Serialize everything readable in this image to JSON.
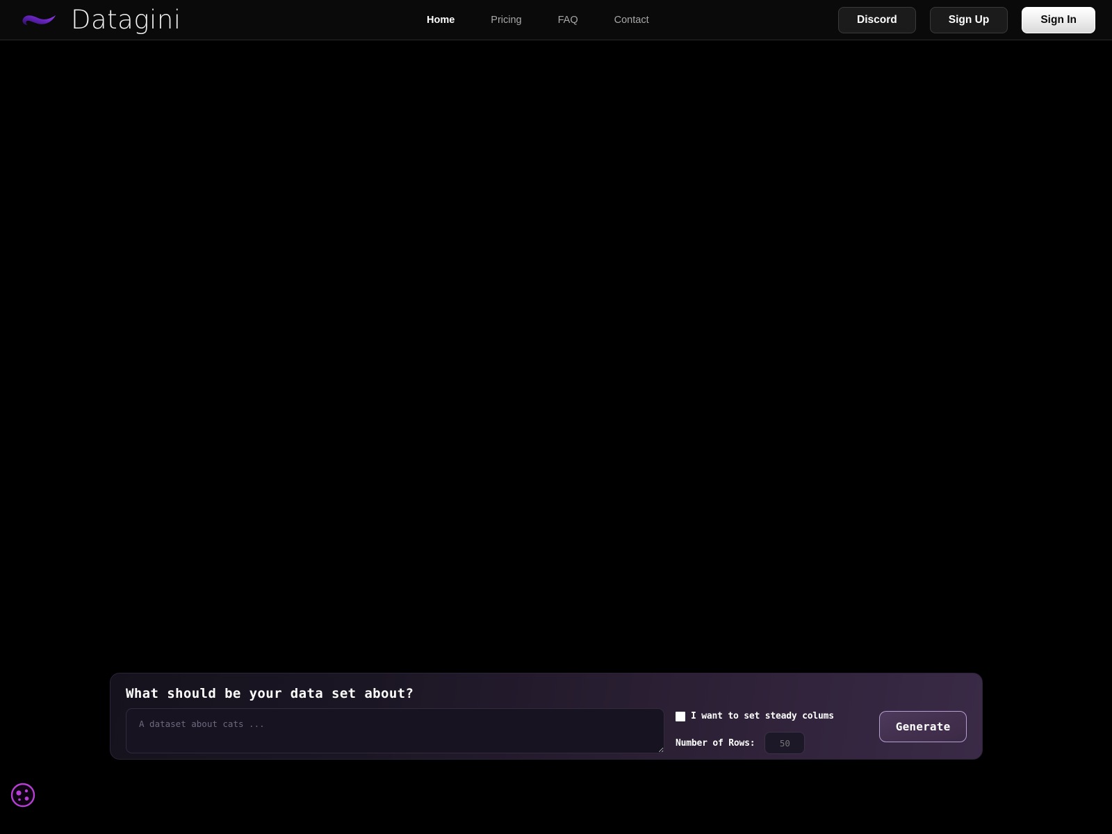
{
  "header": {
    "brand_name": "Datagini",
    "logo_icon": "swoosh-logo-icon",
    "nav": [
      {
        "label": "Home",
        "active": true
      },
      {
        "label": "Pricing",
        "active": false
      },
      {
        "label": "FAQ",
        "active": false
      },
      {
        "label": "Contact",
        "active": false
      }
    ],
    "actions": {
      "discord_label": "Discord",
      "sign_up_label": "Sign Up",
      "sign_in_label": "Sign In"
    }
  },
  "prompt_panel": {
    "title": "What should be your data set about?",
    "textarea": {
      "placeholder": "A dataset about cats ...",
      "value": ""
    },
    "steady_columns": {
      "label": "I want to set steady colums",
      "checked": false
    },
    "rows": {
      "label": "Number of Rows:",
      "value": "50",
      "placeholder": "50"
    },
    "generate_label": "Generate"
  },
  "cookie": {
    "icon": "cookie-icon"
  },
  "colors": {
    "page_background": "#000000",
    "header_background": "#0a0a0a",
    "accent_purple": "#7b2fd6",
    "panel_gradient_start": "#15121d",
    "panel_gradient_end": "#3a2a47",
    "generate_border": "#b79fd0",
    "cookie_purple": "#b83fd6"
  }
}
